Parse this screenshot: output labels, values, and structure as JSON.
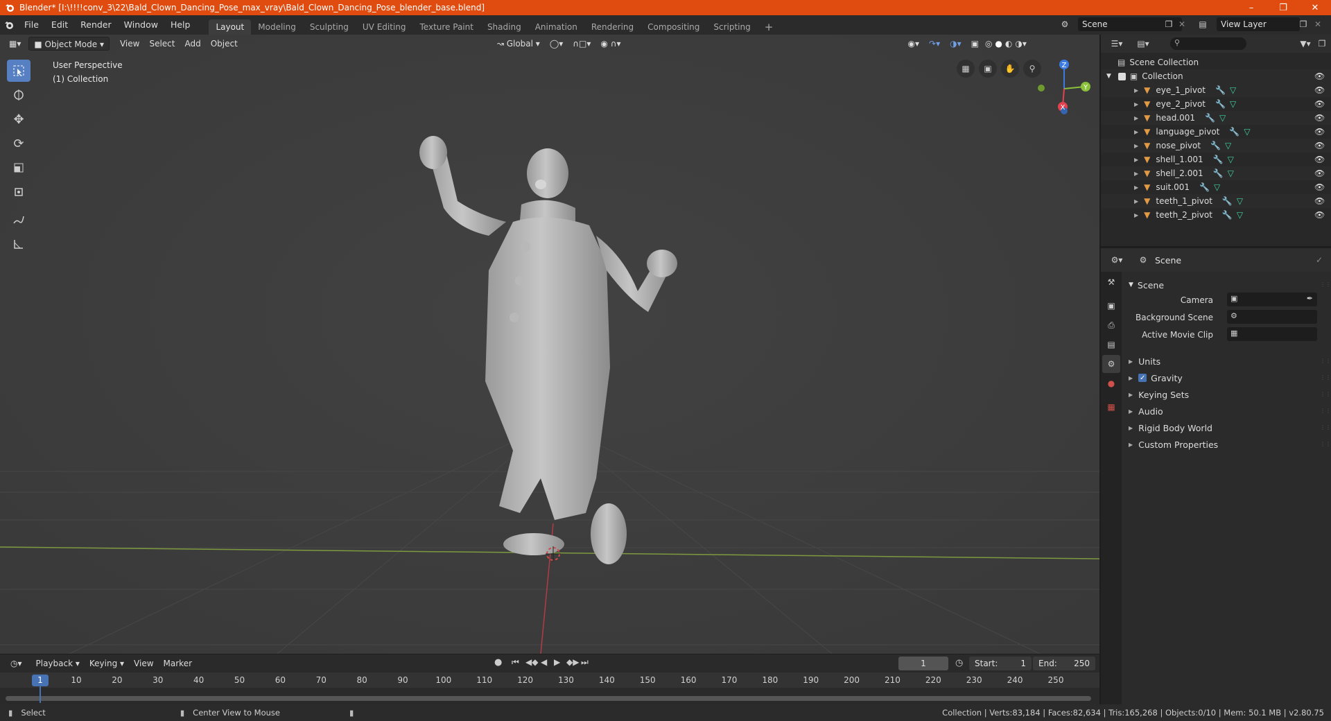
{
  "window": {
    "title": "Blender* [I:\\!!!!conv_3\\22\\Bald_Clown_Dancing_Pose_max_vray\\Bald_Clown_Dancing_Pose_blender_base.blend]",
    "controls": [
      "minimize",
      "maximize",
      "close"
    ]
  },
  "menu": [
    "File",
    "Edit",
    "Render",
    "Window",
    "Help"
  ],
  "workspaces": [
    "Layout",
    "Modeling",
    "Sculpting",
    "UV Editing",
    "Texture Paint",
    "Shading",
    "Animation",
    "Rendering",
    "Compositing",
    "Scripting"
  ],
  "active_workspace": "Layout",
  "scene_name": "Scene",
  "view_layer_name": "View Layer",
  "viewport": {
    "mode": "Object Mode",
    "menus": [
      "View",
      "Select",
      "Add",
      "Object"
    ],
    "transform_orientation": "Global",
    "info_line1": "User Perspective",
    "info_line2": "(1) Collection",
    "gizmo_axes": [
      "X",
      "Y",
      "Z"
    ]
  },
  "tools": [
    "select-box",
    "cursor",
    "move",
    "rotate",
    "scale",
    "transform",
    "annotate",
    "measure"
  ],
  "outliner": {
    "root": "Scene Collection",
    "collection": "Collection",
    "objects": [
      "eye_1_pivot",
      "eye_2_pivot",
      "head.001",
      "language_pivot",
      "nose_pivot",
      "shell_1.001",
      "shell_2.001",
      "suit.001",
      "teeth_1_pivot",
      "teeth_2_pivot"
    ]
  },
  "properties": {
    "header": "Scene",
    "panel": "Scene",
    "fields": {
      "camera_label": "Camera",
      "background_scene_label": "Background Scene",
      "active_movie_clip_label": "Active Movie Clip"
    },
    "sections": [
      "Units",
      "Gravity",
      "Keying Sets",
      "Audio",
      "Rigid Body World",
      "Custom Properties"
    ],
    "gravity_checked": true
  },
  "timeline": {
    "menus": [
      "Playback",
      "Keying",
      "View",
      "Marker"
    ],
    "current_frame": "1",
    "start_label": "Start:",
    "start": "1",
    "end_label": "End:",
    "end": "250",
    "ticks": [
      "1",
      "10",
      "20",
      "30",
      "40",
      "50",
      "60",
      "70",
      "80",
      "90",
      "100",
      "110",
      "120",
      "130",
      "140",
      "150",
      "160",
      "170",
      "180",
      "190",
      "200",
      "210",
      "220",
      "230",
      "240",
      "250"
    ]
  },
  "statusbar": {
    "select": "Select",
    "center_view": "Center View to Mouse",
    "stats": "Collection | Verts:83,184 | Faces:82,634 | Tris:165,268 | Objects:0/10 | Mem: 50.1 MB | v2.80.75"
  },
  "colors": {
    "titlebar": "#e04c0f",
    "accent": "#4772b3",
    "x_axis": "#e0424f",
    "y_axis": "#8bc13a",
    "z_axis": "#3b7be0",
    "mesh_icon": "#e09b44",
    "modifier_icon": "#7ab0e6",
    "data_icon": "#3fd4a3"
  }
}
